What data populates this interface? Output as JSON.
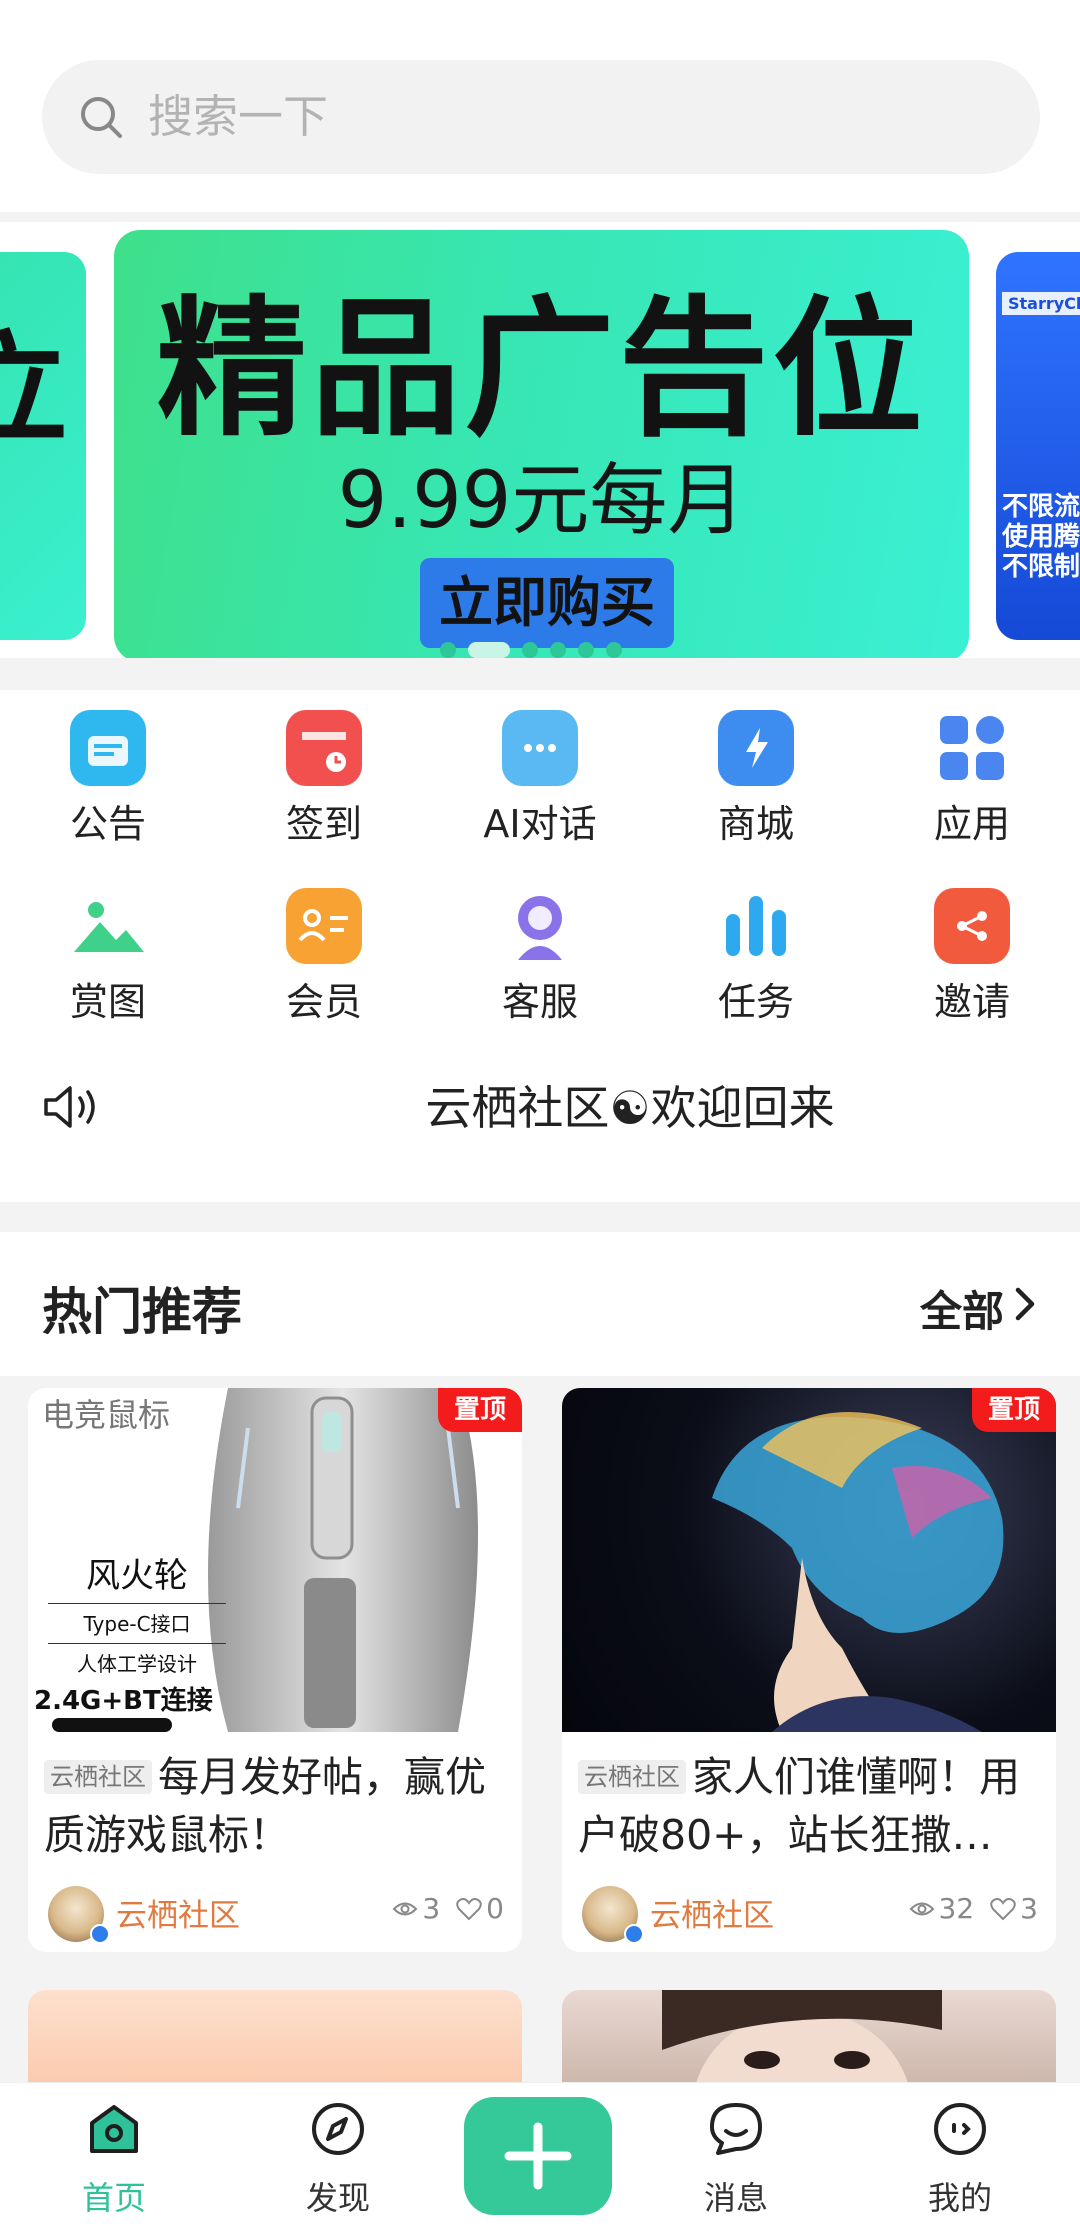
{
  "search": {
    "placeholder": "搜索一下"
  },
  "banner": {
    "left_partial_text": "立",
    "headline": "精品广告位",
    "price": "9.99元每月",
    "cta": "立即购买",
    "right_partial_brand": "StarryCl",
    "right_partial_lines": [
      "不限流",
      "使用腾",
      "不限制"
    ],
    "dots_count": 6,
    "active_dot": 1
  },
  "grid": [
    {
      "label": "公告",
      "icon": "announcement-icon",
      "color": "#2fb8ef"
    },
    {
      "label": "签到",
      "icon": "calendar-checkin-icon",
      "color": "#f2504e"
    },
    {
      "label": "AI对话",
      "icon": "chat-bubble-icon",
      "color": "#5ab9f2"
    },
    {
      "label": "商城",
      "icon": "lightning-icon",
      "color": "#3d8cf0"
    },
    {
      "label": "应用",
      "icon": "apps-icon",
      "color": "#4b86f0"
    },
    {
      "label": "赏图",
      "icon": "landscape-image-icon",
      "color": "#3fd18a"
    },
    {
      "label": "会员",
      "icon": "member-card-icon",
      "color": "#f7a233"
    },
    {
      "label": "客服",
      "icon": "customer-service-icon",
      "color": "#8a72e8"
    },
    {
      "label": "任务",
      "icon": "bar-chart-icon",
      "color": "#2ea8ef"
    },
    {
      "label": "邀请",
      "icon": "share-icon",
      "color": "#f25a3e"
    }
  ],
  "notice": {
    "text": "云栖社区☯欢迎回来"
  },
  "hot": {
    "title": "热门推荐",
    "all_label": "全部"
  },
  "cards": [
    {
      "pin": "置顶",
      "tag": "云栖社区",
      "title": "每月发好帖，赢优质游戏鼠标！",
      "author": "云栖社区",
      "views": "3",
      "likes": "0",
      "image_texts": {
        "category": "电竞鼠标",
        "product": "风火轮",
        "f1": "Type-C接口",
        "f2": "人体工学设计",
        "f3": "2.4G+BT连接"
      }
    },
    {
      "pin": "置顶",
      "tag": "云栖社区",
      "title": "家人们谁懂啊！用户破80+，站长狂撒…",
      "author": "云栖社区",
      "views": "32",
      "likes": "3"
    }
  ],
  "tabbar": [
    {
      "label": "首页",
      "icon": "home-icon",
      "active": true
    },
    {
      "label": "发现",
      "icon": "compass-icon",
      "active": false
    },
    {
      "label": "",
      "icon": "plus-icon",
      "active": false
    },
    {
      "label": "消息",
      "icon": "message-icon",
      "active": false
    },
    {
      "label": "我的",
      "icon": "profile-face-icon",
      "active": false
    }
  ],
  "colors": {
    "accent": "#35c99a",
    "pin": "#f31b1b",
    "author": "#e07a3e"
  }
}
